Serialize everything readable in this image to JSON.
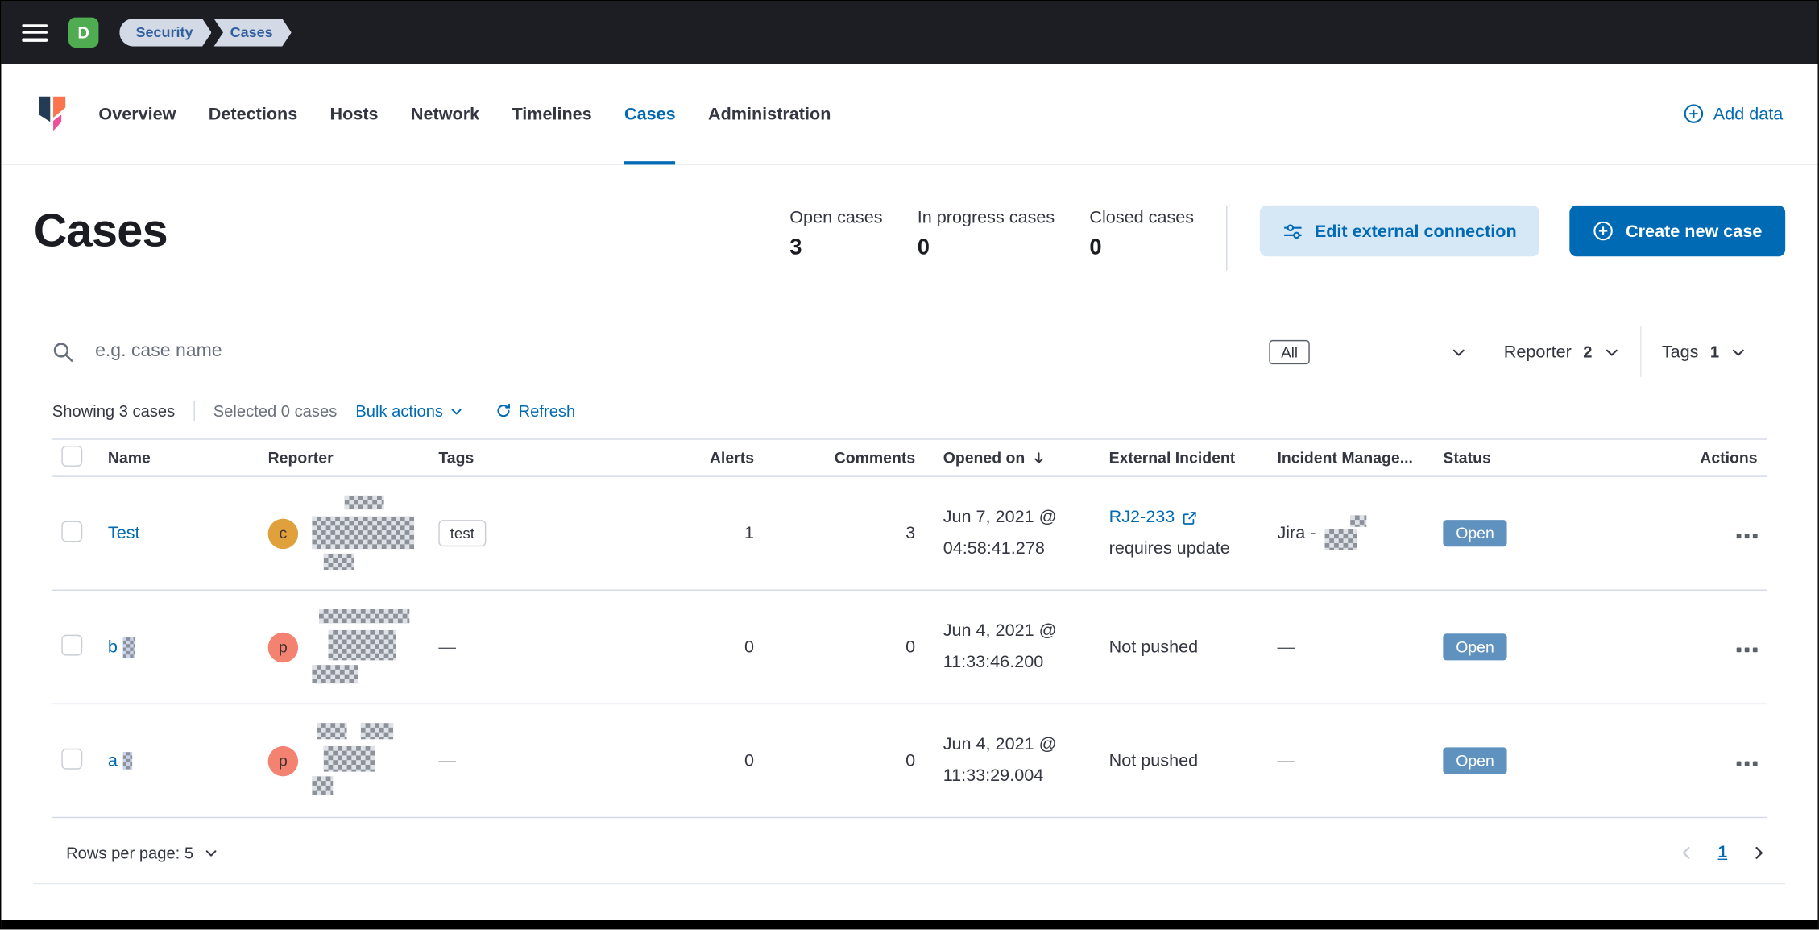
{
  "colors": {
    "topbar_bg": "#1d1e24",
    "accent_blue": "#006bb4",
    "breadcrumb_bg": "#d3dae6",
    "space_avatar_bg": "#4fac50",
    "reporter_avatar_row1_bg": "#e0a03c",
    "reporter_avatar_rows23_bg": "#f38271",
    "status_badge_bg": "#6092c0",
    "divider": "#d3dae6",
    "text_primary": "#343741",
    "text_subdued": "#69707d",
    "primary_button_bg": "#006bb4",
    "secondary_button_bg": "#d6e7f5"
  },
  "icons": {
    "menu": "hamburger-bars",
    "search": "magnifier",
    "chevron_down": "chevron-down",
    "sort_descending": "arrow-down",
    "add": "circled-plus",
    "external_link": "box-with-arrow",
    "refresh": "circular-arrow",
    "edit_connection": "sliders",
    "row_actions": "three-small-squares",
    "page_prev": "chevron-left",
    "page_next": "chevron-right",
    "app_logo": "security-shield"
  },
  "topbar": {
    "space_initial": "D",
    "breadcrumbs": [
      {
        "label": "Security"
      },
      {
        "label": "Cases"
      }
    ]
  },
  "nav": {
    "tabs": [
      {
        "label": "Overview",
        "active": false
      },
      {
        "label": "Detections",
        "active": false
      },
      {
        "label": "Hosts",
        "active": false
      },
      {
        "label": "Network",
        "active": false
      },
      {
        "label": "Timelines",
        "active": false
      },
      {
        "label": "Cases",
        "active": true
      },
      {
        "label": "Administration",
        "active": false
      }
    ],
    "add_data_label": "Add data"
  },
  "header": {
    "title": "Cases",
    "stats": [
      {
        "label": "Open cases",
        "value": "3"
      },
      {
        "label": "In progress cases",
        "value": "0"
      },
      {
        "label": "Closed cases",
        "value": "0"
      }
    ],
    "edit_external_label": "Edit external connection",
    "create_case_label": "Create new case"
  },
  "filters": {
    "search_placeholder": "e.g. case name",
    "status_value": "All",
    "reporter_label": "Reporter",
    "reporter_count": "2",
    "tags_label": "Tags",
    "tags_count": "1"
  },
  "toolbar": {
    "showing": "Showing 3 cases",
    "selected": "Selected 0 cases",
    "bulk_actions": "Bulk actions",
    "refresh": "Refresh"
  },
  "table": {
    "headers": {
      "name": "Name",
      "reporter": "Reporter",
      "tags": "Tags",
      "alerts": "Alerts",
      "comments": "Comments",
      "opened_on": "Opened on",
      "external_incident": "External Incident",
      "incident_management": "Incident Manage...",
      "status": "Status",
      "actions": "Actions"
    },
    "rows": [
      {
        "name": "Test",
        "reporter_initial": "c",
        "tags": "test",
        "alerts": "1",
        "comments": "3",
        "opened_line1": "Jun 7, 2021 @",
        "opened_line2": "04:58:41.278",
        "external_link": "RJ2-233",
        "external_note": "requires update",
        "incident_management": "Jira -",
        "status": "Open"
      },
      {
        "name": "b",
        "reporter_initial": "p",
        "tags": "—",
        "alerts": "0",
        "comments": "0",
        "opened_line1": "Jun 4, 2021 @",
        "opened_line2": "11:33:46.200",
        "external_text": "Not pushed",
        "incident_management": "—",
        "status": "Open"
      },
      {
        "name": "a",
        "reporter_initial": "p",
        "tags": "—",
        "alerts": "0",
        "comments": "0",
        "opened_line1": "Jun 4, 2021 @",
        "opened_line2": "11:33:29.004",
        "external_text": "Not pushed",
        "incident_management": "—",
        "status": "Open"
      }
    ]
  },
  "footer": {
    "rows_per_page": "Rows per page: 5",
    "page": "1"
  }
}
